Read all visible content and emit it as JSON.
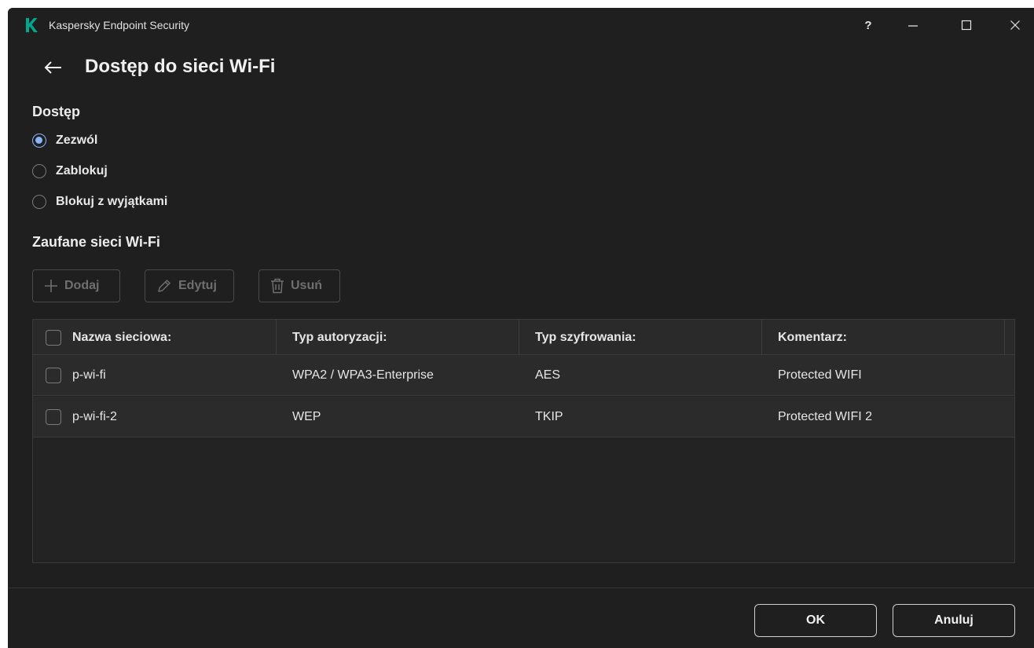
{
  "window": {
    "app_title": "Kaspersky Endpoint Security",
    "help_label": "?",
    "icons": [
      "kaspersky-logo",
      "minimize-icon",
      "maximize-icon",
      "close-icon"
    ]
  },
  "header": {
    "title": "Dostęp do sieci Wi-Fi",
    "back_icon": "arrow-left-icon"
  },
  "access": {
    "heading": "Dostęp",
    "options": [
      {
        "label": "Zezwól",
        "selected": true
      },
      {
        "label": "Zablokuj",
        "selected": false
      },
      {
        "label": "Blokuj z wyjątkami",
        "selected": false
      }
    ]
  },
  "trusted": {
    "heading": "Zaufane sieci Wi-Fi",
    "toolbar": {
      "add_label": "Dodaj",
      "edit_label": "Edytuj",
      "delete_label": "Usuń",
      "add_icon": "plus-icon",
      "edit_icon": "pencil-icon",
      "delete_icon": "trash-icon"
    },
    "table": {
      "columns": [
        "Nazwa sieciowa:",
        "Typ autoryzacji:",
        "Typ szyfrowania:",
        "Komentarz:"
      ],
      "rows": [
        {
          "name": "p-wi-fi",
          "auth": "WPA2 / WPA3-Enterprise",
          "encryption": "AES",
          "comment": "Protected WIFI"
        },
        {
          "name": "p-wi-fi-2",
          "auth": "WEP",
          "encryption": "TKIP",
          "comment": "Protected WIFI 2"
        }
      ]
    }
  },
  "footer": {
    "ok_label": "OK",
    "cancel_label": "Anuluj"
  },
  "colors": {
    "background": "#1f1f1f",
    "accent": "#8ab4f8",
    "logo_green": "#00a88e"
  }
}
